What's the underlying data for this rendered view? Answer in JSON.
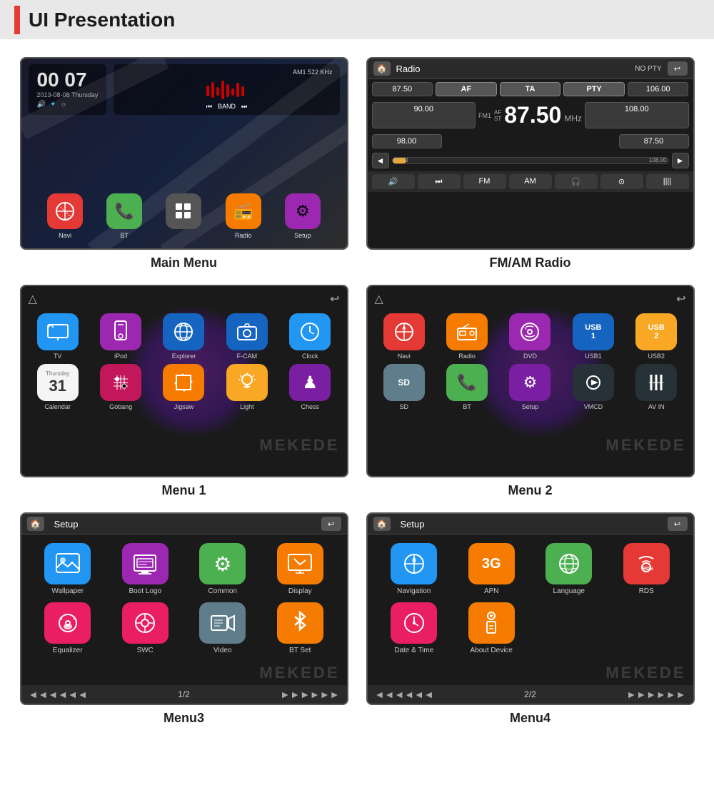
{
  "header": {
    "title": "UI Presentation",
    "accent_color": "#e53935"
  },
  "screens": [
    {
      "id": "main-menu",
      "caption": "Main Menu",
      "clock": {
        "time": "00 07",
        "date": "2013-08-08 Thursday"
      },
      "music": {
        "label": "AM1 522 KHz",
        "band": "BAND"
      },
      "apps": [
        {
          "label": "Navi",
          "color": "#e53935",
          "icon": "🚫"
        },
        {
          "label": "BT",
          "color": "#4caf50",
          "icon": "📞"
        },
        {
          "label": "",
          "color": "#555",
          "icon": "⊞"
        },
        {
          "label": "Radio",
          "color": "#f57c00",
          "icon": "📻"
        },
        {
          "label": "Setup",
          "color": "#9c27b0",
          "icon": "⚙"
        }
      ]
    },
    {
      "id": "fm-am-radio",
      "caption": "FM/AM Radio",
      "title": "Radio",
      "no_pty": "NO PTY",
      "freq_main": "87.50",
      "mhz": "MHz",
      "fm_label": "FM1",
      "freq_rows": [
        [
          "87.50",
          "AF",
          "TA",
          "PTY",
          "106.00"
        ],
        [
          "90.00",
          "",
          "",
          "",
          "108.00"
        ],
        [
          "98.00",
          "",
          "",
          "",
          "87.50"
        ]
      ],
      "controls": [
        "◄◄",
        "FM",
        "AM",
        "🎧",
        "⊙",
        "||||"
      ]
    },
    {
      "id": "menu1",
      "caption": "Menu 1",
      "apps": [
        {
          "label": "TV",
          "color": "#2196f3",
          "icon": "📺"
        },
        {
          "label": "iPod",
          "color": "#9c27b0",
          "icon": "🎵"
        },
        {
          "label": "Explorer",
          "color": "#2196f3",
          "icon": "🌐"
        },
        {
          "label": "F-CAM",
          "color": "#2196f3",
          "icon": "📷"
        },
        {
          "label": "Clock",
          "color": "#2196f3",
          "icon": "🕐"
        },
        {
          "label": "Calendar",
          "color": "#fff",
          "icon": "📅"
        },
        {
          "label": "Gobang",
          "color": "#e91e63",
          "icon": "⬛"
        },
        {
          "label": "Jigsaw",
          "color": "#f57c00",
          "icon": "🧩"
        },
        {
          "label": "Light",
          "color": "#f5c518",
          "icon": "💡"
        },
        {
          "label": "Chess",
          "color": "#9c27b0",
          "icon": "♟"
        }
      ]
    },
    {
      "id": "menu2",
      "caption": "Menu 2",
      "apps": [
        {
          "label": "Navi",
          "color": "#e53935",
          "icon": "🧭"
        },
        {
          "label": "Radio",
          "color": "#f57c00",
          "icon": "📻"
        },
        {
          "label": "DVD",
          "color": "#9c27b0",
          "icon": "💿"
        },
        {
          "label": "USB1",
          "color": "#2196f3",
          "icon": "USB"
        },
        {
          "label": "USB2",
          "color": "#f5c518",
          "icon": "USB"
        },
        {
          "label": "SD",
          "color": "#607d8b",
          "icon": "SD"
        },
        {
          "label": "BT",
          "color": "#4caf50",
          "icon": "📞"
        },
        {
          "label": "Setup",
          "color": "#9c27b0",
          "icon": "⚙"
        },
        {
          "label": "VMCD",
          "color": "#37474f",
          "icon": "▶"
        },
        {
          "label": "AV IN",
          "color": "#37474f",
          "icon": "⚡"
        }
      ]
    },
    {
      "id": "menu3",
      "caption": "Menu3",
      "title": "Setup",
      "page": "1/2",
      "apps": [
        {
          "label": "Wallpaper",
          "color": "#2196f3",
          "icon": "🖼"
        },
        {
          "label": "Boot Logo",
          "color": "#9c27b0",
          "icon": "🖥"
        },
        {
          "label": "Common",
          "color": "#4caf50",
          "icon": "⚙"
        },
        {
          "label": "Display",
          "color": "#f57c00",
          "icon": "🖼"
        },
        {
          "label": "Equalizer",
          "color": "#e91e63",
          "icon": "🚗"
        },
        {
          "label": "SWC",
          "color": "#e91e63",
          "icon": "🔄"
        },
        {
          "label": "Video",
          "color": "#607d8b",
          "icon": "🎬"
        },
        {
          "label": "BT Set",
          "color": "#f57c00",
          "icon": "✱"
        }
      ]
    },
    {
      "id": "menu4",
      "caption": "Menu4",
      "title": "Setup",
      "page": "2/2",
      "apps": [
        {
          "label": "Navigation",
          "color": "#2196f3",
          "icon": "⚙"
        },
        {
          "label": "APN",
          "color": "#f57c00",
          "icon": "3G"
        },
        {
          "label": "Language",
          "color": "#4caf50",
          "icon": "🌐"
        },
        {
          "label": "RDS",
          "color": "#e53935",
          "icon": "RDS"
        },
        {
          "label": "Date & Time",
          "color": "#e91e63",
          "icon": "🕐"
        },
        {
          "label": "About Device",
          "color": "#f57c00",
          "icon": "ℹ"
        }
      ]
    }
  ]
}
